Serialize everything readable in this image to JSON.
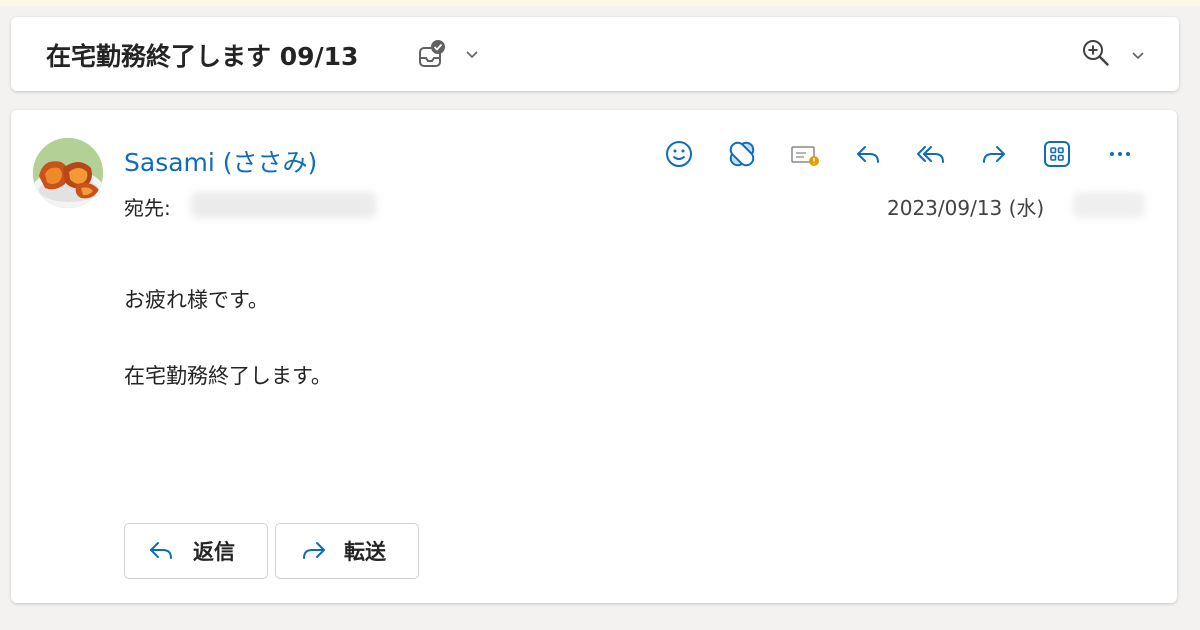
{
  "colors": {
    "accent": "#0f6cbd",
    "text": "#242424",
    "muted": "#424242",
    "border": "#d1d1d1"
  },
  "subject": {
    "title": "在宅勤務終了します 09/13",
    "tag_icon": "mailbox-check-icon",
    "zoom_icon": "zoom-in-icon"
  },
  "message": {
    "sender": "Sasami (ささみ)",
    "avatar_icon": "sweet-potato-avatar",
    "to_label": "宛先:",
    "date": "2023/09/13 (水)",
    "actions": [
      {
        "name": "emoji-icon"
      },
      {
        "name": "bandage-icon"
      },
      {
        "name": "envelope-alert-icon"
      },
      {
        "name": "reply-icon"
      },
      {
        "name": "reply-all-icon"
      },
      {
        "name": "forward-icon"
      },
      {
        "name": "apps-grid-icon"
      },
      {
        "name": "more-icon"
      }
    ],
    "body": [
      "お疲れ様です。",
      "在宅勤務終了します。"
    ]
  },
  "buttons": {
    "reply": "返信",
    "forward": "転送"
  }
}
